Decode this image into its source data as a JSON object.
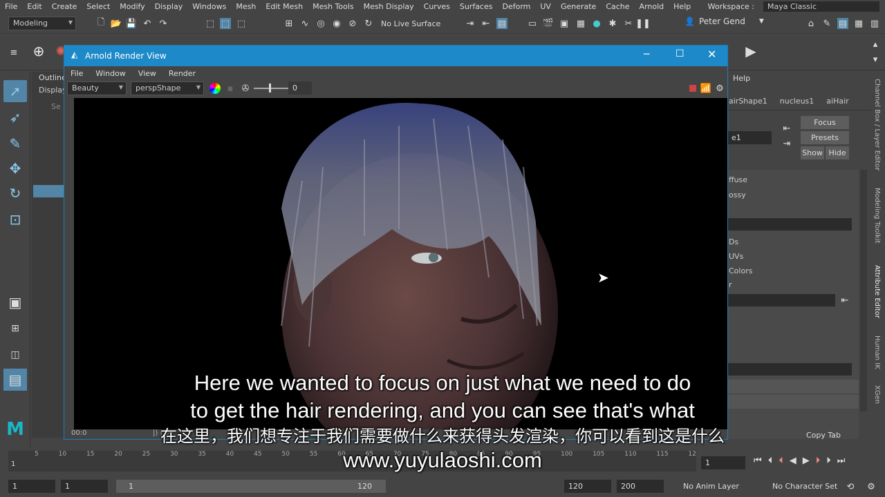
{
  "menubar": {
    "items": [
      "File",
      "Edit",
      "Create",
      "Select",
      "Modify",
      "Display",
      "Windows",
      "Mesh",
      "Edit Mesh",
      "Mesh Tools",
      "Mesh Display",
      "Curves",
      "Surfaces",
      "Deform",
      "UV",
      "Generate",
      "Cache",
      "Arnold",
      "Help"
    ],
    "workspace_label": "Workspace :",
    "workspace_value": "Maya Classic"
  },
  "statusline": {
    "mode": "Modeling",
    "live_surface": "No Live Surface",
    "user": "Peter Gend"
  },
  "outliner": {
    "title": "Outline",
    "menu": "Display",
    "search_placeholder": "Se"
  },
  "attribute_editor": {
    "help": "Help",
    "tabs": [
      "airShape1",
      "nucleus1",
      "aiHair"
    ],
    "node_field": "e1",
    "buttons": {
      "focus": "Focus",
      "presets": "Presets",
      "show": "Show",
      "hide": "Hide"
    },
    "rows": [
      "ffuse",
      "ossy",
      "Ds",
      "UVs",
      "Colors",
      "r"
    ],
    "copy_tab": "Copy Tab"
  },
  "side_tabs": [
    "Channel Box / Layer Editor",
    "Modeling Toolkit",
    "Attribute Editor",
    "Human IK",
    "XGen"
  ],
  "render_view": {
    "title": "Arnold Render View",
    "menu": [
      "File",
      "Window",
      "View",
      "Render"
    ],
    "aov": "Beauty",
    "camera": "perspShape",
    "exposure": "0",
    "status_left": "00:0",
    "status_mid": "|) | pe"
  },
  "timeline": {
    "ticks": [
      "5",
      "10",
      "15",
      "20",
      "25",
      "30",
      "35",
      "40",
      "45",
      "50",
      "55",
      "60",
      "65",
      "70",
      "75",
      "80",
      "85",
      "90",
      "95",
      "100",
      "105",
      "110",
      "115",
      "12"
    ],
    "start_marker": "1",
    "current_frame": "1"
  },
  "range": {
    "start": "1",
    "playback_start": "1",
    "slider_start": "1",
    "slider_end": "120",
    "playback_end": "120",
    "end": "200",
    "anim_layer": "No Anim Layer",
    "char_set": "No Character Set"
  },
  "subtitles": {
    "en_line1": "Here we wanted to focus on just what we need to do",
    "en_line2": "to get the hair rendering, and you can see that's what",
    "zh_line": "在这里，我们想专注于我们需要做什么来获得头发渲染，你可以看到这是什么",
    "url": "www.yuyulaoshi.com"
  }
}
